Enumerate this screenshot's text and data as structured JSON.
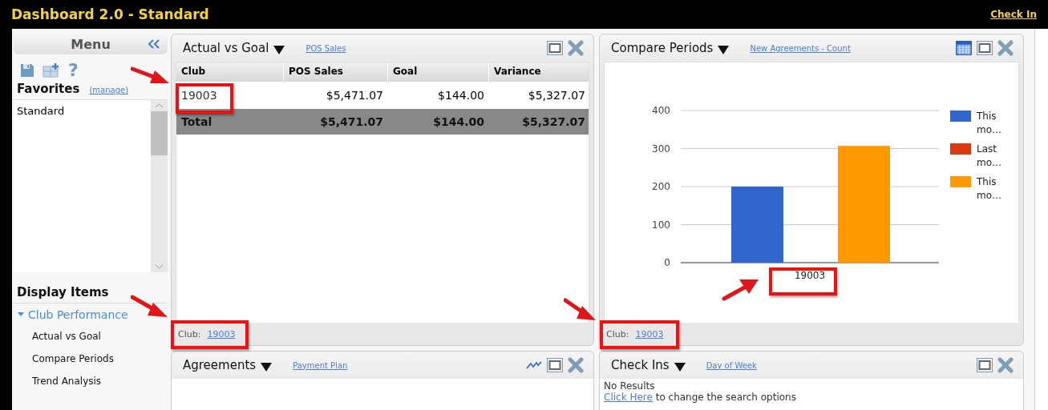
{
  "window": {
    "title": "Dashboard 2.0 - Standard",
    "check_in": "Check In"
  },
  "sidebar": {
    "header": "Menu",
    "help_glyph": "?",
    "favorites_title": "Favorites",
    "manage_link": "(manage)",
    "favorites": [
      {
        "label": "Standard",
        "selected": false
      }
    ],
    "display_title": "Display Items",
    "tree": [
      {
        "label": "Club Performance",
        "expanded": true,
        "children": [
          {
            "label": "Actual vs Goal"
          },
          {
            "label": "Compare Periods"
          },
          {
            "label": "Trend Analysis"
          }
        ]
      }
    ]
  },
  "panels": [
    {
      "kind": "table",
      "title": "Actual vs Goal",
      "link": "POS Sales",
      "tools": [
        {
          "kind": "maximize"
        },
        {
          "kind": "close"
        }
      ],
      "table": {
        "columns": [
          "Club",
          "POS Sales",
          "Goal",
          "Variance"
        ],
        "rows": [
          {
            "kind": "data",
            "cells": [
              "19003",
              "$5,471.07",
              "$144.00",
              "$5,327.07"
            ]
          },
          {
            "kind": "total",
            "cells": [
              "Total",
              "$5,471.07",
              "$144.00",
              "$5,327.07"
            ]
          }
        ]
      },
      "footer": {
        "label": "Club:",
        "link": "19003"
      }
    },
    {
      "kind": "chart",
      "title": "Compare Periods",
      "link": "New Agreements - Count",
      "tools": [
        {
          "kind": "grid"
        },
        {
          "kind": "maximize"
        },
        {
          "kind": "close"
        }
      ],
      "chart_data": {
        "type": "bar",
        "categories": [
          "19003"
        ],
        "series": [
          {
            "name": "This mo…",
            "color": "#3366cc",
            "values": [
              200
            ]
          },
          {
            "name": "Last mo…",
            "color": "#dc3912",
            "values": [
              0
            ]
          },
          {
            "name": "This mo…",
            "color": "#ff9900",
            "values": [
              307
            ]
          }
        ],
        "ylim": [
          0,
          400
        ],
        "yticks": [
          0,
          100,
          200,
          300,
          400
        ],
        "grid": true
      },
      "footer": {
        "label": "Club:",
        "link": "19003"
      }
    },
    {
      "kind": "empty",
      "title": "Agreements",
      "link": "Payment Plan",
      "tools": [
        {
          "kind": "trend"
        },
        {
          "kind": "maximize"
        },
        {
          "kind": "close"
        }
      ]
    },
    {
      "kind": "message",
      "title": "Check Ins",
      "link": "Day of Week",
      "tools": [
        {
          "kind": "maximize"
        },
        {
          "kind": "close"
        }
      ],
      "message": "No Results",
      "action_link": "Click Here",
      "action_text": "to change the search options"
    }
  ]
}
